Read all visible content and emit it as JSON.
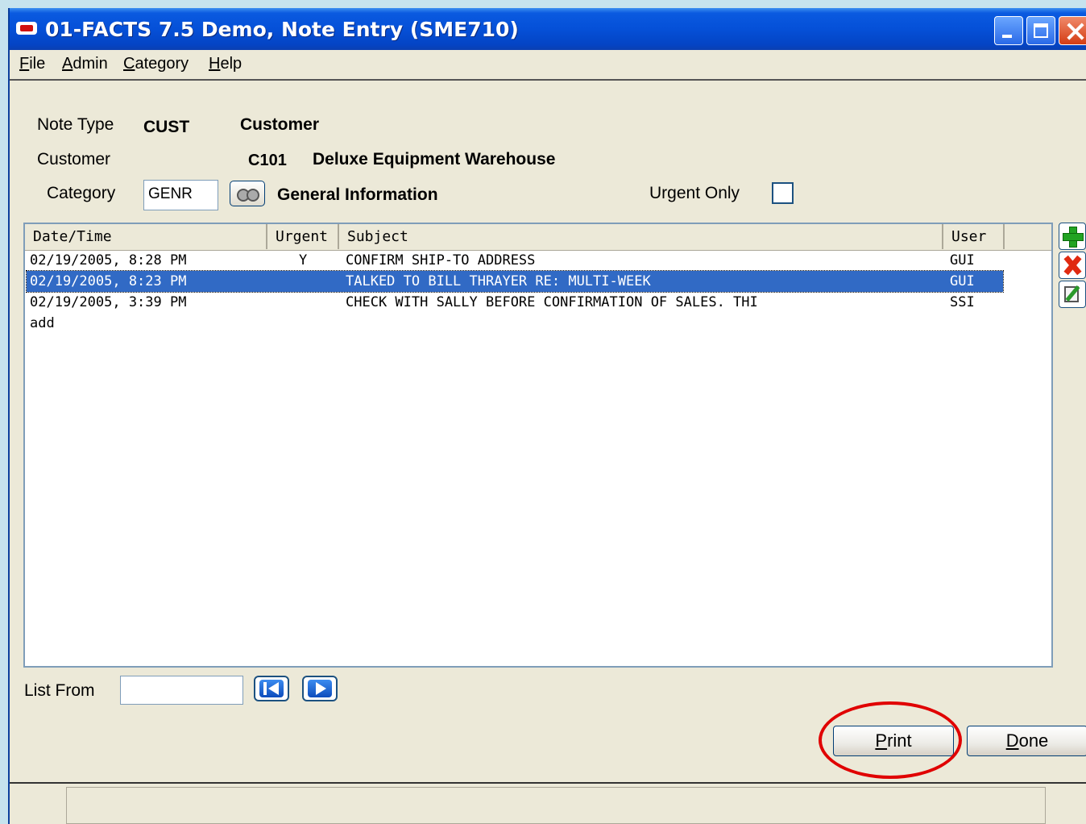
{
  "window": {
    "title": "01-FACTS 7.5 Demo, Note Entry (SME710)"
  },
  "menu": [
    "File",
    "Admin",
    "Category",
    "Help"
  ],
  "form": {
    "note_type_label": "Note Type",
    "note_type_value": "CUST",
    "note_type_desc": "Customer",
    "customer_label": "Customer",
    "customer_id": "C101",
    "customer_name": "Deluxe Equipment Warehouse",
    "category_label": "Category",
    "category_value": "GENR",
    "category_desc": "General Information",
    "urgent_only_label": "Urgent Only",
    "urgent_only_checked": false
  },
  "table": {
    "columns": [
      "Date/Time",
      "Urgent",
      "Subject",
      "User"
    ],
    "rows": [
      {
        "datetime": "02/19/2005, 8:28 PM",
        "urgent": "Y",
        "subject": "CONFIRM SHIP-TO ADDRESS",
        "user": "GUI"
      },
      {
        "datetime": "02/19/2005, 8:23 PM",
        "urgent": "",
        "subject": "TALKED TO BILL THRAYER RE: MULTI-WEEK",
        "user": "GUI"
      },
      {
        "datetime": "02/19/2005, 3:39 PM",
        "urgent": "",
        "subject": "CHECK WITH SALLY BEFORE CONFIRMATION OF SALES. THI",
        "user": "SSI"
      }
    ],
    "add_row_text": "add",
    "selected_row": 1
  },
  "side_icons": [
    "add-icon",
    "delete-icon",
    "edit-icon"
  ],
  "list_from": {
    "label": "List From",
    "value": ""
  },
  "buttons": {
    "print": "Print",
    "done": "Done"
  },
  "colors": {
    "title_bar": "#0550d8",
    "selection": "#316ac5",
    "highlight": "#e00000"
  }
}
